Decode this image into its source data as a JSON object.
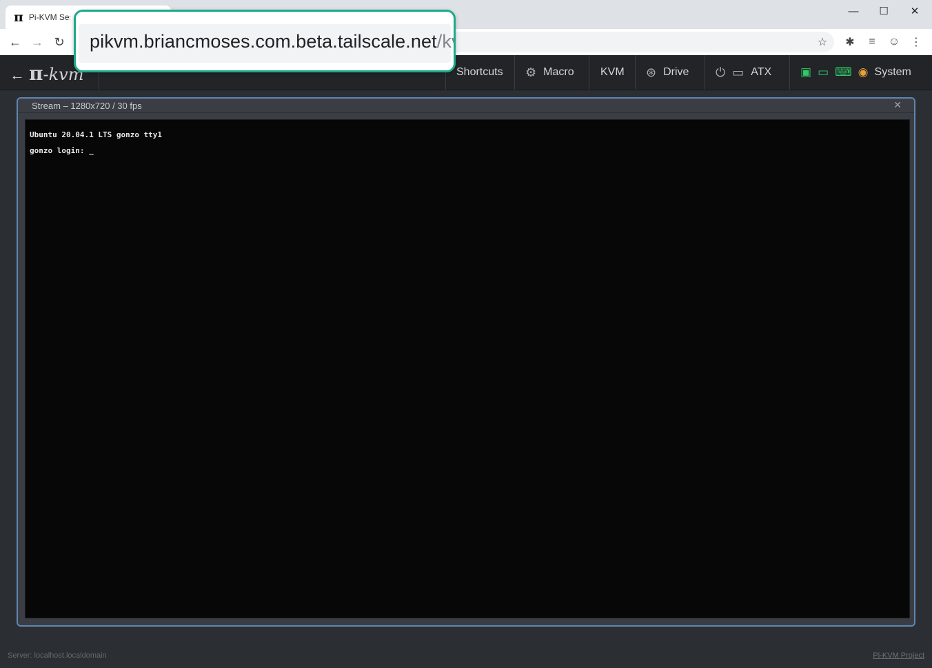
{
  "browser": {
    "tab_title": "Pi-KVM Session",
    "tab_icon_glyph": "π",
    "url_primary": "pikvm.briancmoses.com.beta.tailscale.net",
    "url_path": "/kvm",
    "window_controls": {
      "minimize": "—",
      "maximize": "☐",
      "close": "✕"
    },
    "accent_color": "#1daa8a"
  },
  "kvm": {
    "logo": {
      "arrow": "←",
      "pi": "π",
      "kvm": "-kvm"
    },
    "nav": {
      "shortcuts": "Shortcuts",
      "macro": "Macro",
      "kvm": "KVM",
      "drive": "Drive",
      "atx": "ATX",
      "system": "System"
    },
    "status_icons": [
      "network-icon",
      "monitor-icon",
      "keyboard-icon",
      "mouse-icon"
    ],
    "status_colors": {
      "ok": "#2ec866",
      "warn": "#e8a13a"
    }
  },
  "stream": {
    "title": "Stream – 1280x720 / 30 fps",
    "close": "✕",
    "console": {
      "line1": "Ubuntu 20.04.1 LTS gonzo tty1",
      "line2": "gonzo login: _"
    }
  },
  "footer": {
    "server": "Server: localhost.localdomain",
    "project": "Pi-KVM Project"
  }
}
